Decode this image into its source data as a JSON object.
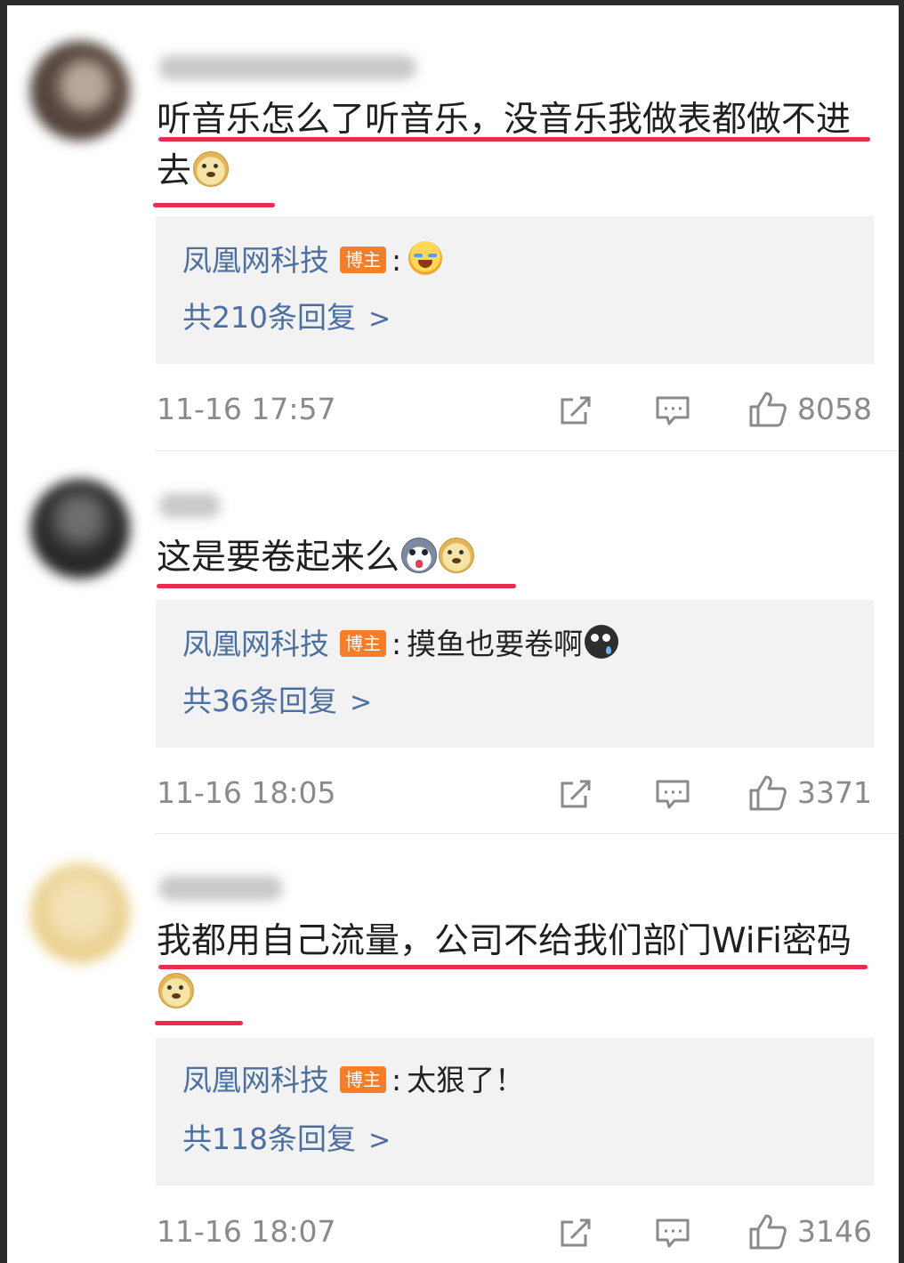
{
  "comments": [
    {
      "text": "听音乐怎么了听音乐，没音乐我做表都做不进去",
      "emojis": [
        "doge-emoji"
      ],
      "reply": {
        "author": "凤凰网科技",
        "badge": "博主",
        "separator": ":",
        "text": "",
        "emojis": [
          "laughing-crying-emoji"
        ],
        "count_label": "共210条回复",
        "chevron": ">"
      },
      "time": "11-16 17:57",
      "likes": "8058"
    },
    {
      "text": "这是要卷起来么",
      "emojis": [
        "husky-emoji",
        "doge-emoji"
      ],
      "reply": {
        "author": "凤凰网科技",
        "badge": "博主",
        "separator": ":",
        "text": "摸鱼也要卷啊",
        "emojis": [
          "sweating-emoji"
        ],
        "count_label": "共36条回复",
        "chevron": ">"
      },
      "time": "11-16 18:05",
      "likes": "3371"
    },
    {
      "text": "我都用自己流量，公司不给我们部门WiFi密码",
      "emojis": [
        "doge-emoji"
      ],
      "reply": {
        "author": "凤凰网科技",
        "badge": "博主",
        "separator": ":",
        "text": "太狠了！",
        "emojis": [],
        "count_label": "共118条回复",
        "chevron": ">"
      },
      "time": "11-16 18:07",
      "likes": "3146"
    }
  ],
  "icons": {
    "share": "share-icon",
    "comment": "comment-icon",
    "like": "thumbs-up-icon"
  },
  "colors": {
    "underline": "#ec2b4f",
    "link": "#4b6fa0",
    "badge": "#f57e2a",
    "meta_text": "#8a8a8a",
    "reply_bg": "#f2f2f2"
  }
}
